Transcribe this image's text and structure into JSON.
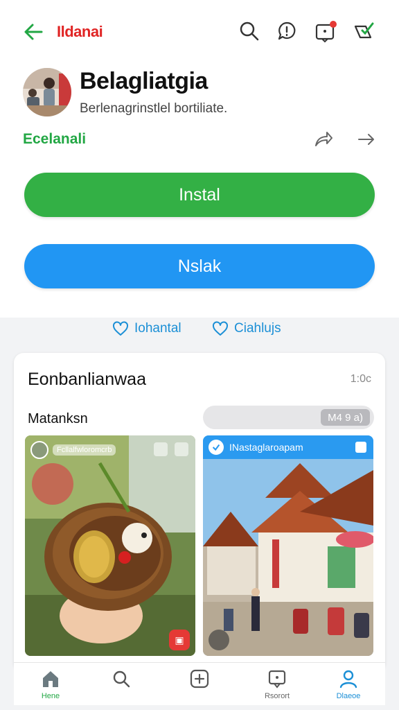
{
  "header": {
    "app_name": "Ildanai",
    "icons": [
      "back-arrow-icon",
      "search-icon",
      "help-icon",
      "notification-icon",
      "shield-icon"
    ],
    "accent_red": "#e02424",
    "accent_green": "#22a744"
  },
  "profile": {
    "name": "Belagliatgia",
    "subtitle": "Berlenagrinstlel bortiliate.",
    "category": "Ecelanali"
  },
  "actions": {
    "install_label": "Instal",
    "open_label": "Nslak",
    "install_color": "#33b045",
    "open_color": "#2196f3"
  },
  "links": [
    {
      "label": "Iohantal",
      "icon": "heart-icon"
    },
    {
      "label": "Ciahlujs",
      "icon": "heart-icon"
    }
  ],
  "card": {
    "title": "Eonbanlianwaa",
    "time": "1:0c",
    "label": "Matanksn",
    "pill_chip": "M4 9 a)",
    "tiles": [
      {
        "user_text": "Fcllalfwloromcrb",
        "type": "food-photo"
      },
      {
        "header_text": "INastaglaroapam",
        "type": "street-photo"
      }
    ]
  },
  "bottom_nav": [
    {
      "label": "Hene",
      "icon": "home-icon"
    },
    {
      "label": "",
      "icon": "search-icon"
    },
    {
      "label": "",
      "icon": "add-icon"
    },
    {
      "label": "Rsorort",
      "icon": "report-icon"
    },
    {
      "label": "Dlaeoe",
      "icon": "profile-icon"
    }
  ]
}
